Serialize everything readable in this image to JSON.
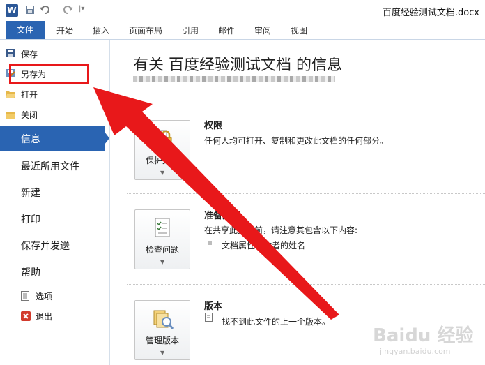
{
  "titlebar": {
    "app_icon": "W",
    "doc_title": "百度经验测试文档.docx",
    "quick_access": [
      "save-icon",
      "undo-icon",
      "redo-icon",
      "customize-icon"
    ]
  },
  "ribbon": {
    "file_tab": "文件",
    "tabs": [
      "开始",
      "插入",
      "页面布局",
      "引用",
      "邮件",
      "审阅",
      "视图"
    ]
  },
  "sidebar": {
    "small_top": [
      {
        "label": "保存",
        "icon": "save-icon"
      },
      {
        "label": "另存为",
        "icon": "save-as-icon"
      },
      {
        "label": "打开",
        "icon": "open-folder-icon"
      },
      {
        "label": "关闭",
        "icon": "close-folder-icon"
      }
    ],
    "active": "信息",
    "big": [
      "最近所用文件",
      "新建",
      "打印",
      "保存并发送",
      "帮助"
    ],
    "small_bottom": [
      {
        "label": "选项",
        "icon": "options-icon"
      },
      {
        "label": "退出",
        "icon": "exit-icon"
      }
    ]
  },
  "main": {
    "title": "有关 百度经验测试文档 的信息",
    "sections": [
      {
        "button": "保护文档",
        "icon": "lock-icon",
        "title": "权限",
        "text": "任何人均可打开、复制和更改此文档的任何部分。"
      },
      {
        "button": "检查问题",
        "icon": "checklist-icon",
        "title": "准备共享",
        "text": "在共享此文件前，请注意其包含以下内容:",
        "bullet": "文档属性和作者的姓名"
      },
      {
        "button": "管理版本",
        "icon": "versions-icon",
        "title": "版本",
        "text": "找不到此文件的上一个版本。"
      }
    ]
  },
  "annotation": {
    "highlight_color": "#e8181a",
    "arrow_color": "#e8181a"
  },
  "watermark": {
    "text": "Baidu 经验",
    "sub": "jingyan.baidu.com"
  },
  "colors": {
    "accent": "#2a64b2"
  }
}
